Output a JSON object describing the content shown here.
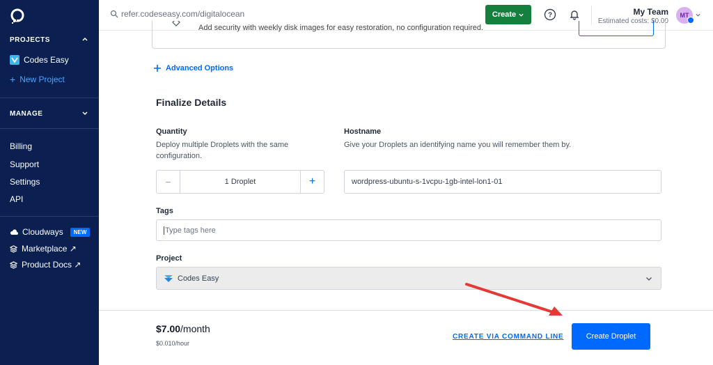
{
  "sidebar": {
    "projects_heading": "PROJECTS",
    "project_item": "Codes Easy",
    "new_project": "New Project",
    "manage_heading": "MANAGE",
    "links": [
      "Billing",
      "Support",
      "Settings",
      "API"
    ],
    "cloudways": "Cloudways",
    "cloudways_badge": "NEW",
    "marketplace": "Marketplace ↗",
    "product_docs": "Product Docs ↗"
  },
  "topbar": {
    "search_text": "refer.codeseasy.com/digitalocean",
    "create_label": "Create",
    "team_name": "My Team",
    "estimated_costs": "Estimated costs: $0.00",
    "avatar_initials": "MT"
  },
  "backup": {
    "text": "Add security with weekly disk images for easy restoration, no configuration required."
  },
  "advanced_options": "Advanced Options",
  "finalize": {
    "heading": "Finalize Details",
    "quantity_label": "Quantity",
    "quantity_desc_1": "Deploy multiple Droplets with the same",
    "quantity_desc_2": "configuration.",
    "quantity_value": "1  Droplet",
    "hostname_label": "Hostname",
    "hostname_desc": "Give your Droplets an identifying name you will remember them by.",
    "hostname_value": "wordpress-ubuntu-s-1vcpu-1gb-intel-lon1-01",
    "tags_label": "Tags",
    "tags_placeholder": "Type tags here",
    "project_label": "Project",
    "project_value": "Codes Easy"
  },
  "footer": {
    "price_amount": "$7.00",
    "price_unit": "/month",
    "price_hour": "$0.010/hour",
    "cli_link": "CREATE VIA COMMAND LINE",
    "create_droplet": "Create Droplet"
  },
  "colors": {
    "sidebar_bg": "#0b2050",
    "accent": "#0069ff",
    "create_green": "#15803d",
    "arrow_red": "#e53935"
  }
}
